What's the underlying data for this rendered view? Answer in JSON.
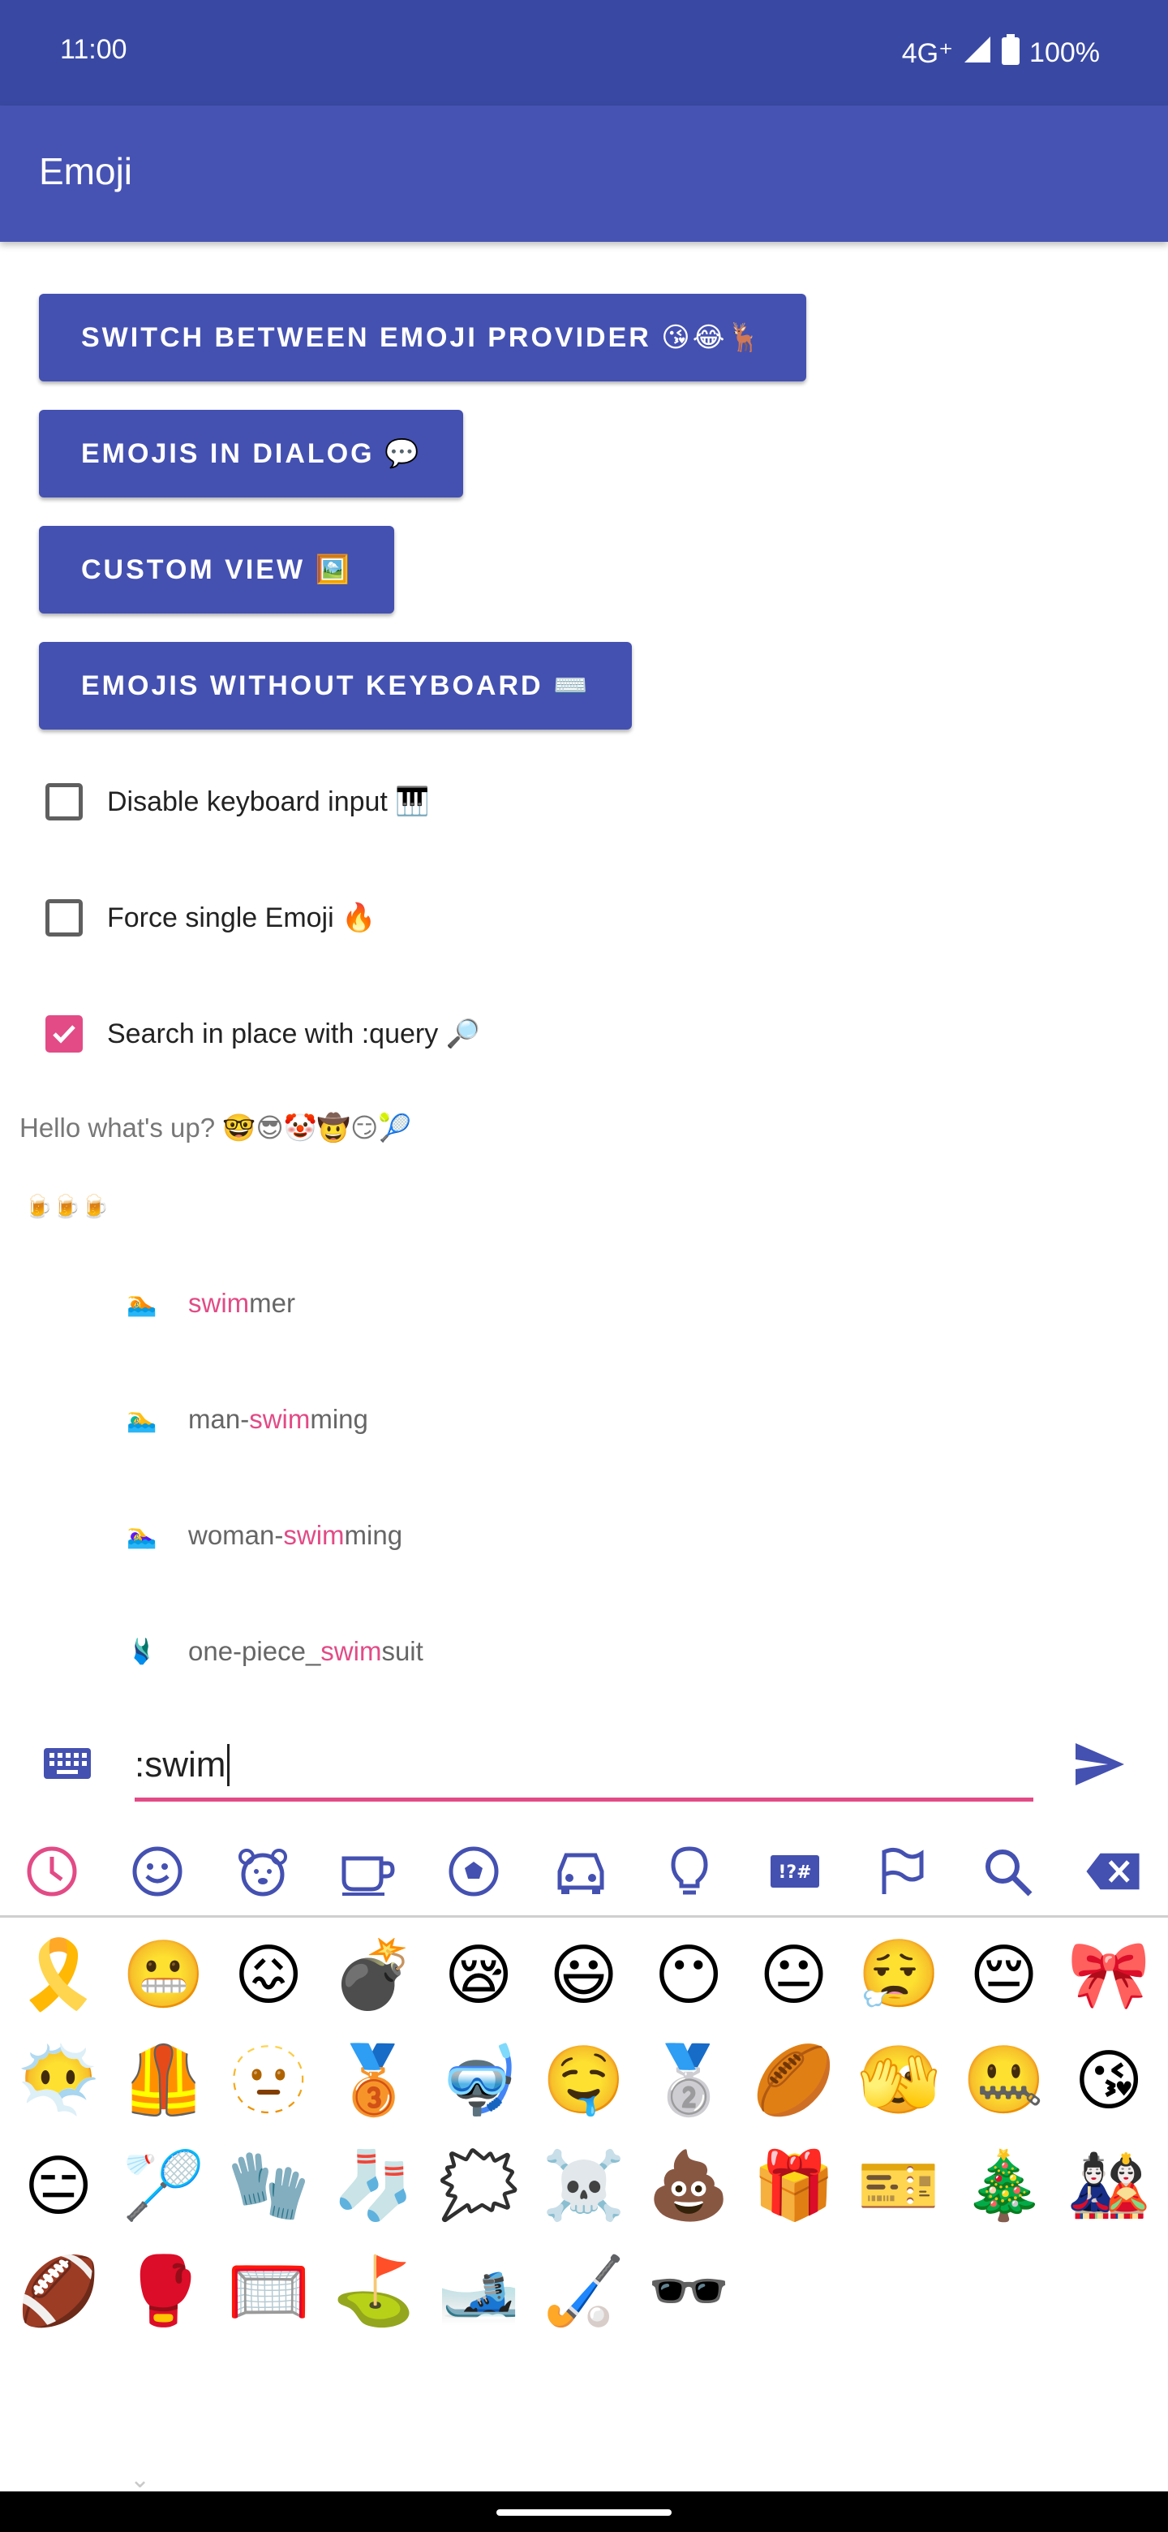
{
  "status": {
    "time": "11:00",
    "network": "4G⁺",
    "battery": "100%"
  },
  "appbar": {
    "title": "Emoji"
  },
  "buttons": {
    "switch_provider": "SWITCH BETWEEN EMOJI PROVIDER 😘😂🦌",
    "dialog": "EMOJIS IN DIALOG 💬",
    "custom_view": "CUSTOM VIEW 🖼️",
    "without_keyboard": "EMOJIS WITHOUT KEYBOARD ⌨️"
  },
  "checkboxes": {
    "disable_keyboard": {
      "label": "Disable keyboard input 🎹",
      "checked": false
    },
    "force_single": {
      "label": "Force single Emoji 🔥",
      "checked": false
    },
    "search_in_place": {
      "label": "Search in place with :query 🔎",
      "checked": true
    }
  },
  "messages": {
    "hello": "Hello what's up? 🤓😎🤡🤠😏🎾",
    "beers": "🍺🍺🍺"
  },
  "suggestions": [
    {
      "icon": "🏊",
      "prefix": "",
      "match": "swim",
      "suffix": "mer"
    },
    {
      "icon": "🏊‍♂️",
      "prefix": "man-",
      "match": "swim",
      "suffix": "ming"
    },
    {
      "icon": "🏊‍♀️",
      "prefix": "woman-",
      "match": "swim",
      "suffix": "ming"
    },
    {
      "icon": "🩱",
      "prefix": "one-piece_",
      "match": "swim",
      "suffix": "suit"
    }
  ],
  "input": {
    "value": ":swim"
  },
  "tabs": [
    "recent-icon",
    "smiley-icon",
    "bear-icon",
    "cup-icon",
    "soccer-icon",
    "car-icon",
    "bulb-icon",
    "symbols-icon",
    "flag-icon",
    "search-icon",
    "backspace-icon"
  ],
  "emoji_grid": [
    [
      "🎗️",
      "😬",
      "😖",
      "💣",
      "😪",
      "😃",
      "😶",
      "😐",
      "😮‍💨",
      "😔",
      "🎀"
    ],
    [
      "😶‍🌫️",
      "🦺",
      "🫥",
      "🥉",
      "🤿",
      "🤤",
      "🥈",
      "🏉",
      "🫣",
      "🤐",
      "😘"
    ],
    [
      "😑",
      "🏸",
      "🧤",
      "🧦",
      "🗯️",
      "☠️",
      "💩",
      "🎁",
      "🎫",
      "🎄",
      "🎎"
    ],
    [
      "🏈",
      "🥊",
      "🥅",
      "⛳",
      "🎿",
      "🏑",
      "🕶️"
    ]
  ],
  "colors": {
    "primary": "#4753b3",
    "status_bar": "#3949a3",
    "accent": "#e24b86"
  }
}
